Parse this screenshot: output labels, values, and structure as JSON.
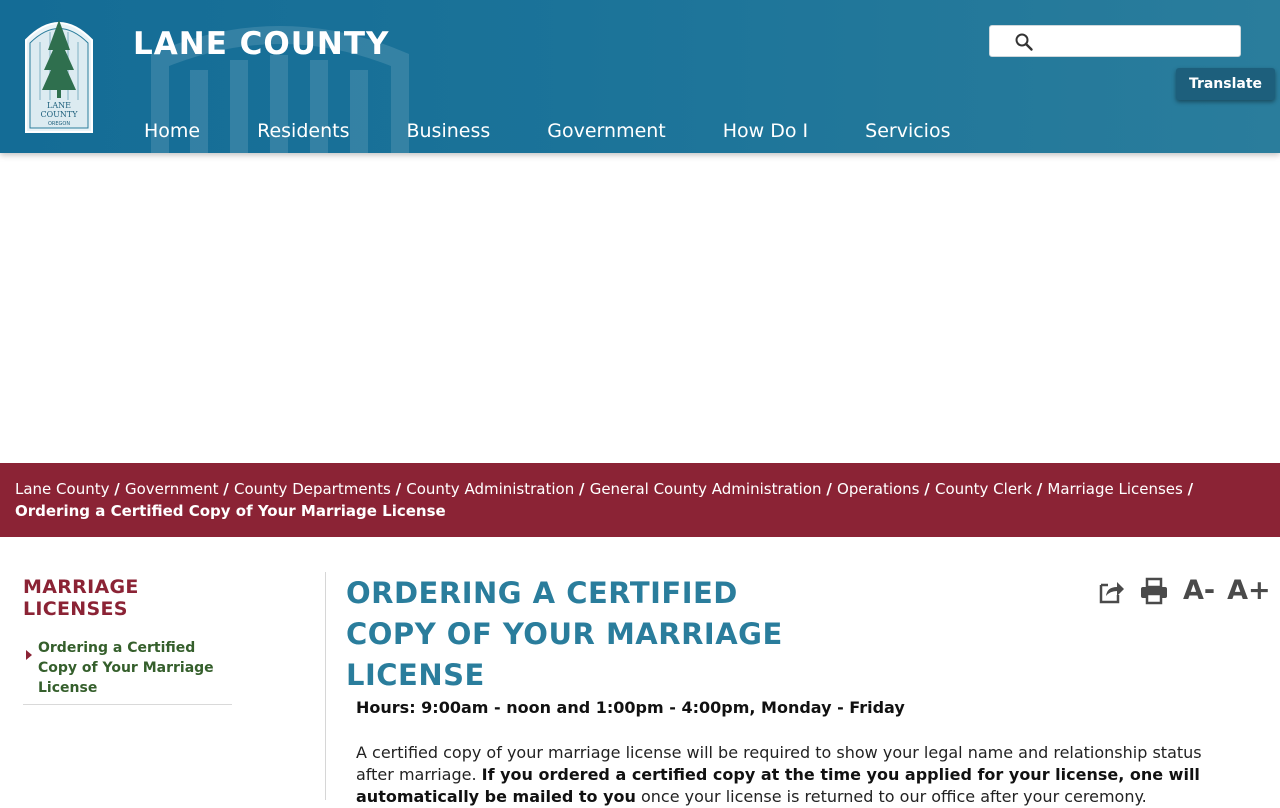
{
  "header": {
    "site_title": "LANE COUNTY",
    "logo_text": [
      "LANE",
      "COUNTY",
      "OREGON"
    ],
    "search_placeholder": "",
    "translate_label": "Translate",
    "nav": [
      "Home",
      "Residents",
      "Business",
      "Government",
      "How Do I",
      "Servicios"
    ]
  },
  "breadcrumb": {
    "items": [
      "Lane County",
      "Government",
      "County Departments",
      "County Administration",
      "General County Administration",
      "Operations",
      "County Clerk",
      "Marriage Licenses"
    ],
    "separator": "/",
    "current": "Ordering a Certified Copy of Your Marriage License"
  },
  "sidebar": {
    "title": "MARRIAGE LICENSES",
    "items": [
      {
        "label": "Ordering a Certified Copy of Your Marriage License"
      }
    ]
  },
  "main": {
    "title": "ORDERING A CERTIFIED COPY OF YOUR MARRIAGE LICENSE",
    "tools": {
      "font_decrease": "A-",
      "font_increase": "A+"
    },
    "hours": "Hours:  9:00am - noon and 1:00pm - 4:00pm, Monday - Friday",
    "para1_start": "A certified copy of your marriage license will be required to show your legal name and relationship status after marriage. ",
    "para1_bold": "If you ordered a certified copy at the time you applied for your license, one will automatically be mailed to you",
    "para1_end": " once your license is returned to our office after your ceremony."
  },
  "colors": {
    "header_blue": "#146c96",
    "breadcrumb_red": "#8b2335",
    "title_teal": "#2a7d9c",
    "sidebar_link_green": "#355f2c"
  }
}
